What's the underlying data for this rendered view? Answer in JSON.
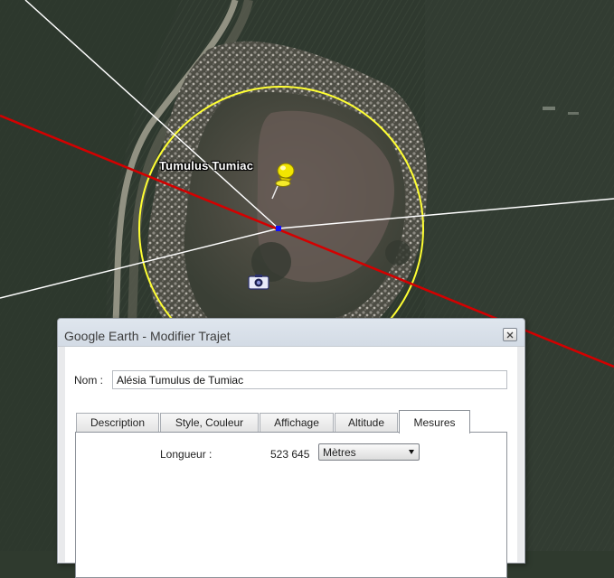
{
  "map": {
    "placemark_label": "Tumulus Tumiac",
    "colors": {
      "path_line": "#d40000",
      "ruler_lines": "#ffffff",
      "circle": "#ffff33",
      "center_point": "#1010ff",
      "pushpin": "#f2e500"
    },
    "icons": [
      "pushpin-icon",
      "camera-icon"
    ]
  },
  "dialog": {
    "title": "Google Earth - Modifier Trajet",
    "name_label": "Nom :",
    "name_value": "Alésia Tumulus de Tumiac",
    "tabs": [
      {
        "label": "Description"
      },
      {
        "label": "Style, Couleur"
      },
      {
        "label": "Affichage"
      },
      {
        "label": "Altitude"
      },
      {
        "label": "Mesures",
        "active": true
      }
    ],
    "measures": {
      "length_label": "Longueur :",
      "length_value": "523 645",
      "unit_selected": "Mètres"
    }
  }
}
